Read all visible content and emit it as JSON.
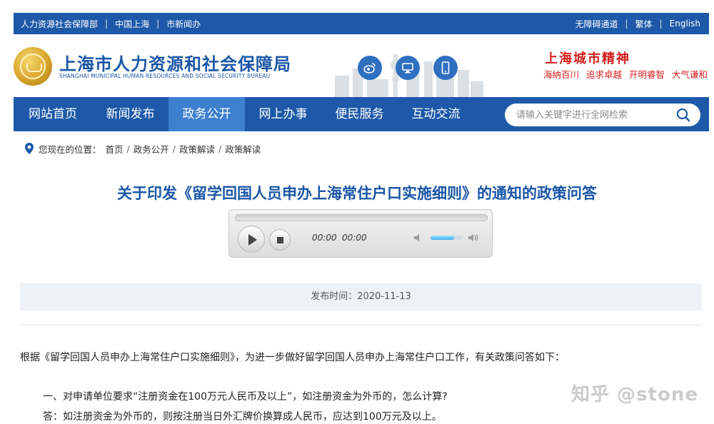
{
  "topbar": {
    "links_left": [
      "人力资源社会保障部",
      "中国上海",
      "市新闻办"
    ],
    "links_right": [
      "无障碍通道",
      "繁体",
      "English"
    ]
  },
  "header": {
    "site_name": "上海市人力资源和社会保障局",
    "site_name_en": "SHANGHAI MUNICIPAL HUMAN RESOURCES AND SOCIAL SECURITY BUREAU",
    "spirit_title": "上海城市精神",
    "spirit_motto": [
      "海纳百川",
      "追求卓越",
      "开明睿智",
      "大气谦和"
    ],
    "icons": [
      "weibo-icon",
      "desktop-icon",
      "mobile-icon"
    ]
  },
  "nav": {
    "items": [
      "网站首页",
      "新闻发布",
      "政务公开",
      "网上办事",
      "便民服务",
      "互动交流"
    ],
    "active_index": 2,
    "search_placeholder": "请输入关键字进行全网检索"
  },
  "breadcrumb": {
    "label": "您现在的位置：",
    "items": [
      "首页",
      "政务公开",
      "政策解读",
      "政策解读"
    ]
  },
  "article": {
    "title": "关于印发《留学回国人员申办上海常住户口实施细则》的通知的政策问答",
    "publish_date": "发布时间：2020-11-13",
    "intro": "根据《留学回国人员申办上海常住户口实施细则》，为进一步做好留学回国人员申办上海常住户口工作，有关政策问答如下：",
    "q1": "一、对申请单位要求“注册资金在100万元人民币及以上”，如注册资金为外币的，怎么计算?",
    "a1": "答：如注册资金为外币的，则按注册当日外汇牌价换算成人民币，应达到100万元及以上。"
  },
  "player": {
    "current_time": "00:00",
    "duration": "00:00",
    "volume": 0.75
  },
  "watermark": "知乎 @stone",
  "colors": {
    "primary": "#1d59a8",
    "nav_active": "#3e7fd0",
    "title": "#1a56a6",
    "spirit": "#d61e1e"
  }
}
